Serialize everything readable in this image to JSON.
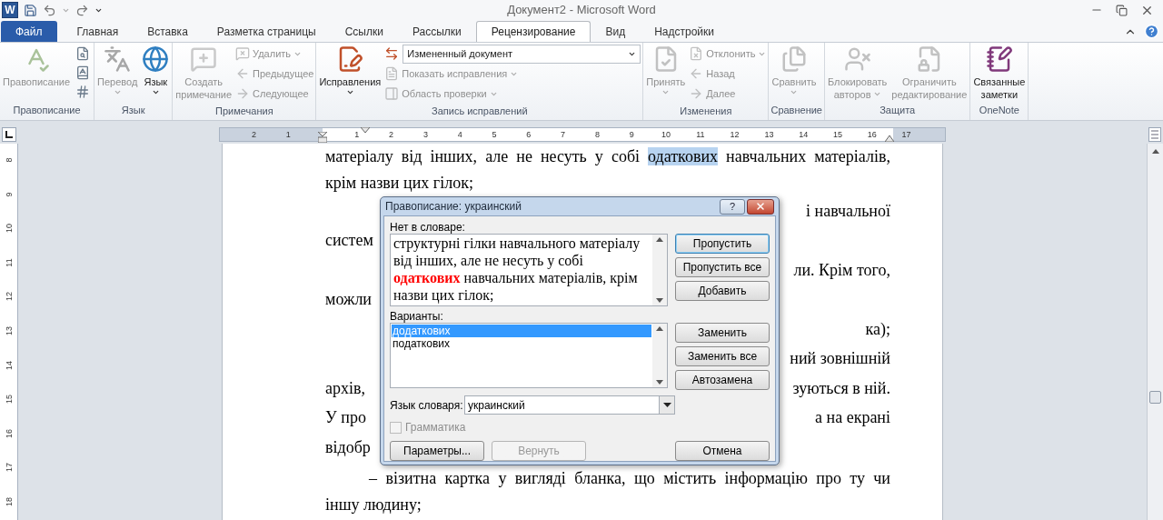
{
  "window": {
    "app_icon": "W",
    "title": "Документ2 - Microsoft Word"
  },
  "tabs": [
    {
      "label": "Файл",
      "kind": "file",
      "selected": false
    },
    {
      "label": "Главная",
      "kind": "tab",
      "selected": false
    },
    {
      "label": "Вставка",
      "kind": "tab",
      "selected": false
    },
    {
      "label": "Разметка страницы",
      "kind": "tab",
      "selected": false
    },
    {
      "label": "Ссылки",
      "kind": "tab",
      "selected": false
    },
    {
      "label": "Рассылки",
      "kind": "tab",
      "selected": false
    },
    {
      "label": "Рецензирование",
      "kind": "tab",
      "selected": true
    },
    {
      "label": "Вид",
      "kind": "tab",
      "selected": false
    },
    {
      "label": "Надстройки",
      "kind": "tab",
      "selected": false
    }
  ],
  "ribbon": {
    "groups": [
      {
        "title": "Правописание",
        "items": [
          {
            "kind": "large",
            "label": "Правописание",
            "caret": false,
            "disabled": true
          },
          {
            "kind": "icon",
            "disabled": false
          },
          {
            "kind": "icon",
            "disabled": false
          },
          {
            "kind": "icon",
            "disabled": false
          }
        ]
      },
      {
        "title": "Язык",
        "items": [
          {
            "kind": "large",
            "label": "Перевод",
            "caret": true,
            "disabled": true
          },
          {
            "kind": "large",
            "label": "Язык",
            "caret": true,
            "disabled": false
          }
        ]
      },
      {
        "title": "Примечания",
        "items": [
          {
            "kind": "large",
            "label": "Создать\nпримечание",
            "caret": false,
            "disabled": true
          },
          {
            "kind": "small",
            "label": "Удалить",
            "caret": true,
            "disabled": true
          },
          {
            "kind": "small",
            "label": "Предыдущее",
            "caret": false,
            "disabled": true
          },
          {
            "kind": "small",
            "label": "Следующее",
            "caret": false,
            "disabled": true
          }
        ]
      },
      {
        "title": "Запись исправлений",
        "items": [
          {
            "kind": "large",
            "label": "Исправления",
            "caret": true,
            "disabled": false
          },
          {
            "kind": "select",
            "value": "Измененный документ",
            "disabled": false
          },
          {
            "kind": "small",
            "label": "Показать исправления",
            "caret": true,
            "disabled": true
          },
          {
            "kind": "small",
            "label": "Область проверки",
            "caret": true,
            "disabled": true
          }
        ]
      },
      {
        "title": "Изменения",
        "items": [
          {
            "kind": "large",
            "label": "Принять",
            "caret": true,
            "disabled": true
          },
          {
            "kind": "small",
            "label": "Отклонить",
            "caret": true,
            "disabled": true
          },
          {
            "kind": "small",
            "label": "Назад",
            "caret": false,
            "disabled": true
          },
          {
            "kind": "small",
            "label": "Далее",
            "caret": false,
            "disabled": true
          }
        ]
      },
      {
        "title": "Сравнение",
        "items": [
          {
            "kind": "large",
            "label": "Сравнить",
            "caret": true,
            "disabled": true
          }
        ]
      },
      {
        "title": "Защита",
        "items": [
          {
            "kind": "large",
            "label": "Блокировать\nавторов",
            "caret": true,
            "disabled": true
          },
          {
            "kind": "large",
            "label": "Ограничить\nредактирование",
            "caret": false,
            "disabled": true
          }
        ]
      },
      {
        "title": "OneNote",
        "items": [
          {
            "kind": "large",
            "label": "Связанные\nзаметки",
            "caret": false,
            "disabled": false
          }
        ]
      }
    ]
  },
  "ruler": {
    "labels": [
      "2",
      "1",
      "1",
      "2",
      "3",
      "4",
      "5",
      "6",
      "7",
      "8",
      "9",
      "10",
      "11",
      "12",
      "13",
      "14",
      "15",
      "16",
      "17"
    ]
  },
  "vertical_ruler": {
    "labels": [
      "8",
      "9",
      "10",
      "11",
      "12",
      "13",
      "14",
      "15",
      "16",
      "17",
      "18"
    ]
  },
  "document": {
    "lines": [
      {
        "kind": "full",
        "indent": false,
        "parts": [
          {
            "text": "матеріалу від інших, але не несуть у собі ",
            "selected": false
          },
          {
            "text": "одаткових",
            "selected": true
          },
          {
            "text": " навчальних матеріалів,",
            "selected": false
          }
        ]
      },
      {
        "kind": "end",
        "indent": false,
        "parts": [
          {
            "text": "крім назви цих гілок;",
            "selected": false
          }
        ]
      },
      {
        "kind": "split",
        "right": "і навчальної"
      },
      {
        "kind": "split",
        "left": "систем"
      },
      {
        "kind": "split",
        "right": "ли. Крім того,"
      },
      {
        "kind": "split",
        "left": "можли"
      },
      {
        "kind": "split",
        "right": "ка);"
      },
      {
        "kind": "split",
        "right": "ний зовнішній"
      },
      {
        "kind": "split",
        "left": "архів,",
        "right": "зуються в ній."
      },
      {
        "kind": "split",
        "left": "У про",
        "right": "а на екрані"
      },
      {
        "kind": "split",
        "left": "відобр"
      },
      {
        "kind": "full",
        "indent": true,
        "parts": [
          {
            "text": "– візитна картка у вигляді бланка, що містить інформацію про ту чи",
            "selected": false
          }
        ]
      },
      {
        "kind": "end",
        "indent": false,
        "parts": [
          {
            "text": "іншу людину;",
            "selected": false
          }
        ]
      }
    ]
  },
  "dialog": {
    "title": "Правописание: украинский",
    "help": "?",
    "not_in_dictionary_label": "Нет в словаре:",
    "sentence": "структурні гілки навчального матеріалу від інших, але не несуть у собі **одаткових** навчальних матеріалів, крім назви цих гілок;",
    "suggestions_label": "Варианты:",
    "suggestions": [
      {
        "text": "додаткових",
        "selected": true
      },
      {
        "text": "податкових",
        "selected": false
      }
    ],
    "language_label": "Язык словаря:",
    "language": "украинский",
    "grammar": {
      "label": "Грамматика",
      "checked": false,
      "disabled": true
    },
    "side_buttons": [
      [
        {
          "label": "Пропустить",
          "default": true,
          "disabled": false
        },
        {
          "label": "Пропустить все",
          "default": false,
          "disabled": false
        },
        {
          "label": "Добавить",
          "default": false,
          "disabled": false
        }
      ],
      [
        {
          "label": "Заменить",
          "default": false,
          "disabled": false
        },
        {
          "label": "Заменить все",
          "default": false,
          "disabled": false
        },
        {
          "label": "Автозамена",
          "default": false,
          "disabled": false
        }
      ]
    ],
    "bottom_buttons": [
      {
        "label": "Параметры...",
        "disabled": false
      },
      {
        "label": "Вернуть",
        "disabled": true
      }
    ],
    "cancel_button": {
      "label": "Отмена",
      "disabled": false
    }
  }
}
